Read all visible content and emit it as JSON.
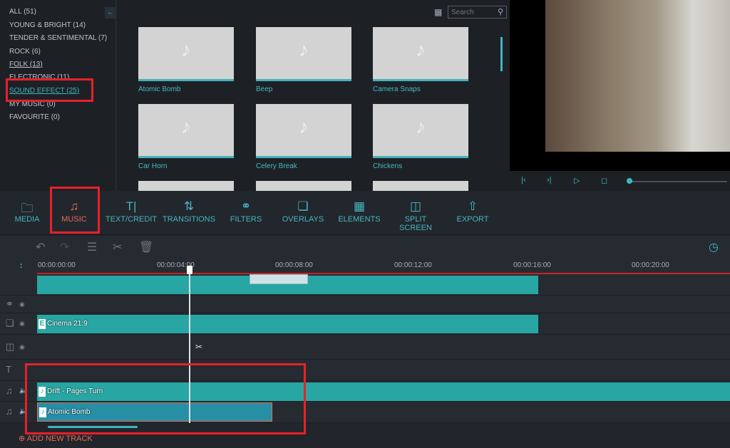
{
  "categories": [
    {
      "label": "ALL (51)"
    },
    {
      "label": "YOUNG & BRIGHT (14)"
    },
    {
      "label": "TENDER & SENTIMENTAL (7)"
    },
    {
      "label": "ROCK (6)"
    },
    {
      "label": "FOLK (13)"
    },
    {
      "label": "ELECTRONIC (11)"
    },
    {
      "label": "SOUND EFFECT (25)"
    },
    {
      "label": "MY MUSIC (0)"
    },
    {
      "label": "FAVOURITE (0)"
    }
  ],
  "selected_category": "SOUND EFFECT (25)",
  "search": {
    "placeholder": "Search"
  },
  "tiles": [
    {
      "label": "Atomic Bomb"
    },
    {
      "label": "Beep"
    },
    {
      "label": "Camera Snaps"
    },
    {
      "label": "Car Horn"
    },
    {
      "label": "Celery Break"
    },
    {
      "label": "Chickens"
    }
  ],
  "tools": [
    {
      "label": "MEDIA",
      "icon": "folder-icon"
    },
    {
      "label": "MUSIC",
      "icon": "music-icon"
    },
    {
      "label": "TEXT/CREDIT",
      "icon": "text-icon"
    },
    {
      "label": "TRANSITIONS",
      "icon": "transitions-icon"
    },
    {
      "label": "FILTERS",
      "icon": "filters-icon"
    },
    {
      "label": "OVERLAYS",
      "icon": "overlays-icon"
    },
    {
      "label": "ELEMENTS",
      "icon": "elements-icon"
    },
    {
      "label": "SPLIT SCREEN",
      "icon": "split-screen-icon"
    },
    {
      "label": "EXPORT",
      "icon": "export-icon"
    }
  ],
  "active_tool": "MUSIC",
  "ruler": [
    "00:00:00:00",
    "00:00:04:00",
    "00:00:08:00",
    "00:00:12:00",
    "00:00:16:00",
    "00:00:20:00"
  ],
  "clips": {
    "overlay": "Cinema 21:9",
    "audio1": "Drift - Pages Turn",
    "audio2": "Atomic Bomb"
  },
  "add_track": "ADD NEW TRACK",
  "colors": {
    "accent": "#3fb6bf",
    "active": "#e36a55",
    "clip": "#27a6a4",
    "highlight": "#e8202a"
  }
}
